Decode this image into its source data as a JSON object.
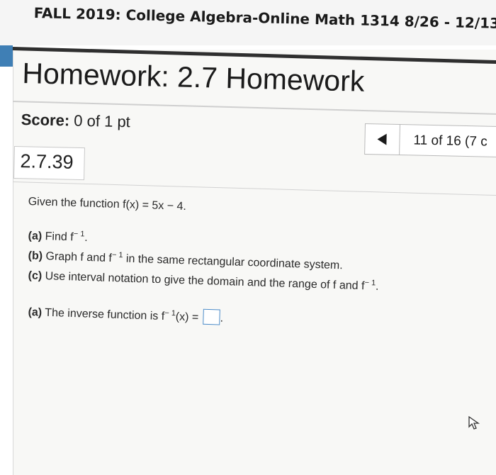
{
  "course": {
    "title": "FALL 2019: College Algebra-Online Math 1314 8/26 - 12/13"
  },
  "homework": {
    "title": "Homework: 2.7 Homework"
  },
  "score": {
    "label": "Score:",
    "value": "0 of 1 pt"
  },
  "navigation": {
    "progress_text": "11 of 16 (7 c",
    "prev_icon": "left-triangle"
  },
  "problem": {
    "number": "2.7.39",
    "prompt": "Given the function f(x) = 5x − 4.",
    "part_a_label": "(a)",
    "part_a_text": "Find f",
    "part_b_label": "(b)",
    "part_b_text_1": "Graph f and f",
    "part_b_text_2": "in the same rectangular coordinate system.",
    "part_c_label": "(c)",
    "part_c_text": "Use interval notation to give the domain and the range of f and f",
    "answer_label": "(a)",
    "answer_text_1": "The inverse function is f",
    "answer_text_2": "(x) =",
    "superscript": "− 1",
    "period": "."
  },
  "colors": {
    "accent": "#3f7fb5",
    "input_border": "#4b8bc8"
  }
}
